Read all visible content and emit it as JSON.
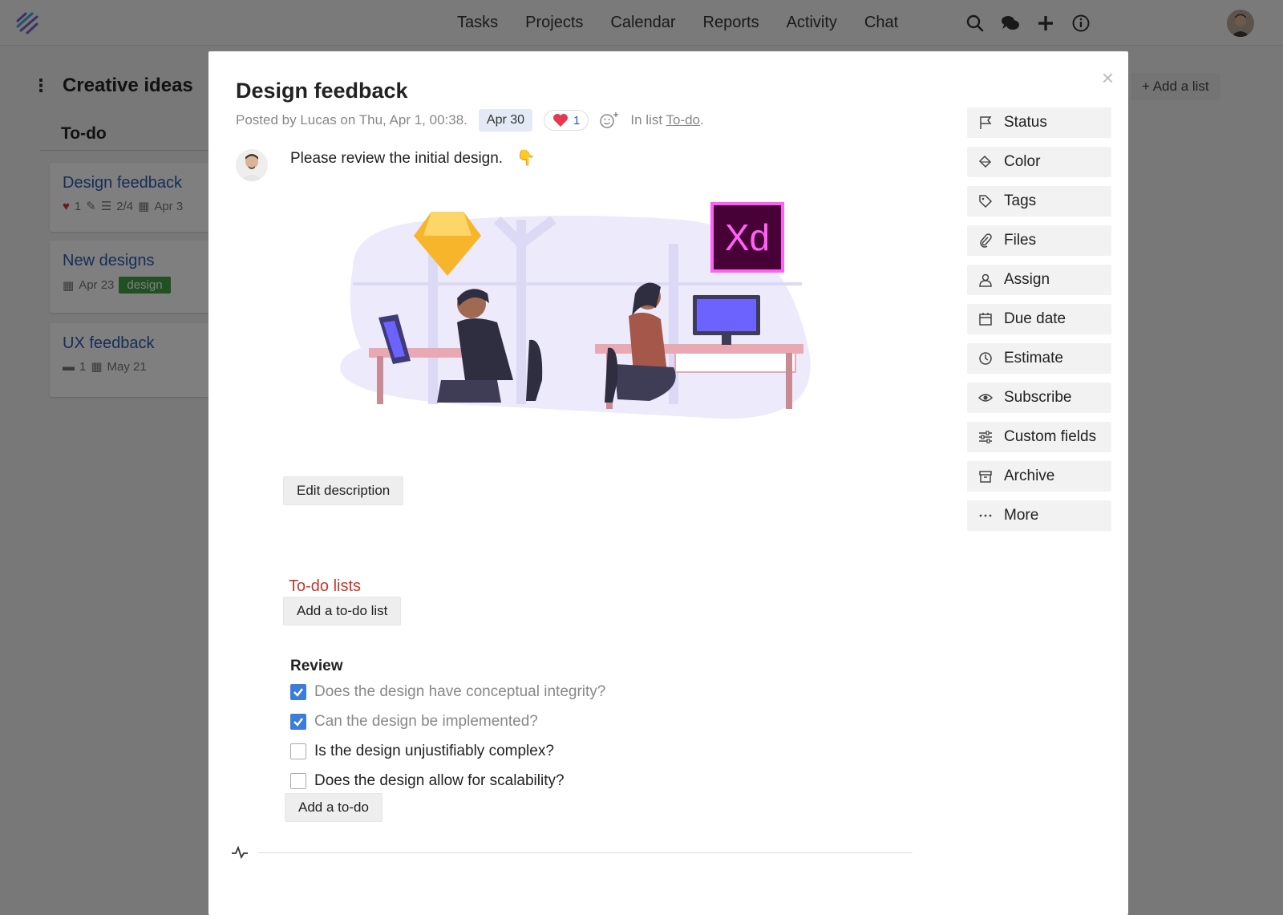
{
  "nav": {
    "items": [
      "Tasks",
      "Projects",
      "Calendar",
      "Reports",
      "Activity",
      "Chat"
    ],
    "icons": [
      "search-icon",
      "chat-bubbles-icon",
      "plus-icon",
      "info-icon"
    ]
  },
  "board": {
    "title": "Creative ideas",
    "list_title": "To-do",
    "add_list": "Add a list",
    "cards": [
      {
        "title": "Design feedback",
        "likes": "1",
        "todos": "2/4",
        "date": "Apr 3"
      },
      {
        "title": "New designs",
        "date": "Apr 23",
        "tag": "design"
      },
      {
        "title": "UX feedback",
        "comments": "1",
        "date": "May 21"
      }
    ]
  },
  "modal": {
    "title": "Design feedback",
    "posted": "Posted by Lucas on Thu, Apr 1, 00:38.",
    "due": "Apr 30",
    "likes": "1",
    "in_list_prefix": "In list",
    "in_list_name": "To-do",
    "in_list_suffix": ".",
    "description": "Please review the initial design.",
    "description_emoji": "👇",
    "illustration_logo": "Xd",
    "edit_description": "Edit description",
    "todo_lists_heading": "To-do lists",
    "add_todo_list": "Add a to-do list",
    "review": {
      "title": "Review",
      "items": [
        {
          "text": "Does the design have conceptual integrity?",
          "done": true
        },
        {
          "text": "Can the design be implemented?",
          "done": true
        },
        {
          "text": "Is the design unjustifiably complex?",
          "done": false
        },
        {
          "text": "Does the design allow for scalability?",
          "done": false
        }
      ],
      "add_todo": "Add a to-do"
    },
    "actions": [
      "Status",
      "Color",
      "Tags",
      "Files",
      "Assign",
      "Due date",
      "Estimate",
      "Subscribe",
      "Custom fields",
      "Archive",
      "More"
    ],
    "close": "×"
  },
  "colors": {
    "accent_blue": "#3b7dd8",
    "link_blue": "#2a5db0",
    "todo_heading_red": "#c0392b",
    "tag_green": "#43a047"
  }
}
